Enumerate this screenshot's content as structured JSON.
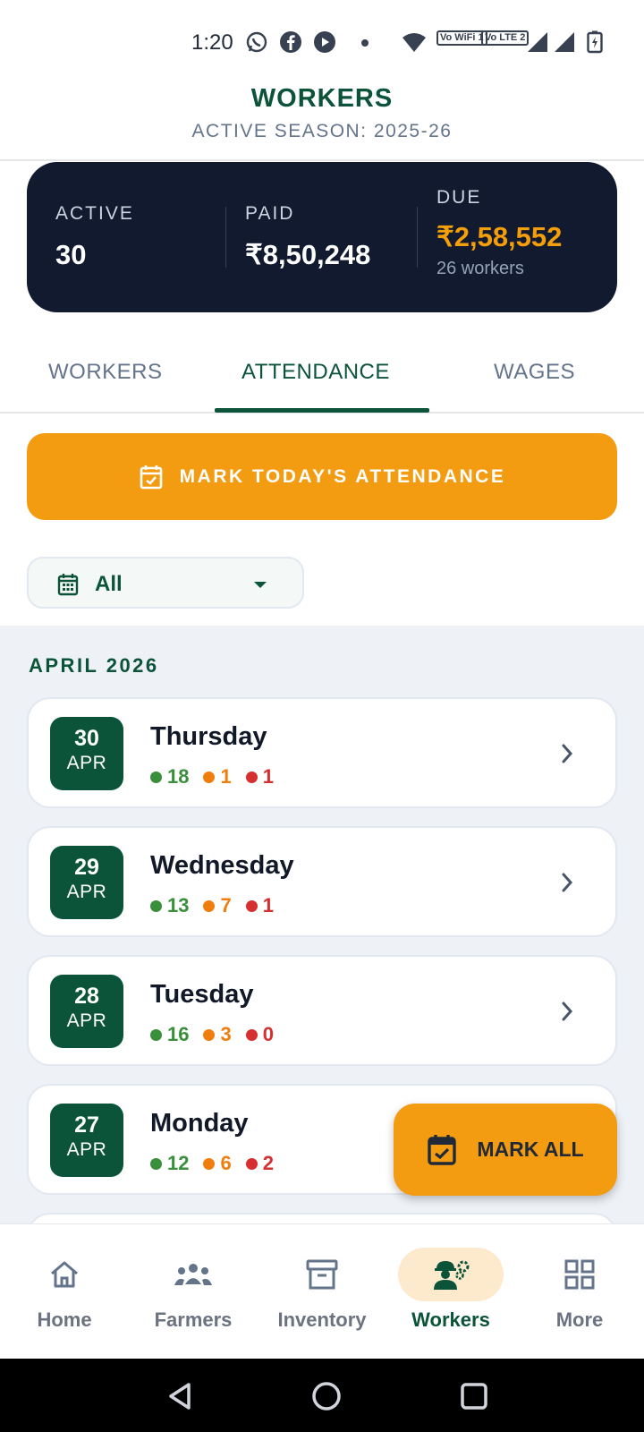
{
  "status_bar": {
    "time": "1:20",
    "icons": [
      "whatsapp-icon",
      "facebook-icon",
      "youtube-icon",
      "dot-icon",
      "wifi-icon",
      "vowifi-icon",
      "volte-icon",
      "signal-icon",
      "signal-icon",
      "battery-icon"
    ],
    "wifi_badge": "Vo WiFi 1",
    "lte_badge": "Vo LTE 2"
  },
  "header": {
    "title": "WORKERS",
    "subtitle": "ACTIVE SEASON: 2025-26"
  },
  "summary": {
    "active": {
      "label": "ACTIVE",
      "value": "30"
    },
    "paid": {
      "label": "PAID",
      "value": "₹8,50,248"
    },
    "due": {
      "label": "DUE",
      "value": "₹2,58,552",
      "note": "26 workers"
    }
  },
  "tabs": [
    {
      "label": "WORKERS",
      "active": false
    },
    {
      "label": "ATTENDANCE",
      "active": true
    },
    {
      "label": "WAGES",
      "active": false
    }
  ],
  "mark_button": {
    "label": "MARK TODAY'S ATTENDANCE",
    "icon": "calendar-check-icon"
  },
  "filter": {
    "selected": "All",
    "icon": "calendar-icon"
  },
  "month_label": "APRIL 2026",
  "days": [
    {
      "date": "30",
      "month": "APR",
      "weekday": "Thursday",
      "present": "18",
      "half": "1",
      "absent": "1"
    },
    {
      "date": "29",
      "month": "APR",
      "weekday": "Wednesday",
      "present": "13",
      "half": "7",
      "absent": "1"
    },
    {
      "date": "28",
      "month": "APR",
      "weekday": "Tuesday",
      "present": "16",
      "half": "3",
      "absent": "0"
    },
    {
      "date": "27",
      "month": "APR",
      "weekday": "Monday",
      "present": "12",
      "half": "6",
      "absent": "2"
    }
  ],
  "fab": {
    "label": "MARK ALL",
    "icon": "calendar-check-icon"
  },
  "bottom_nav": [
    {
      "label": "Home",
      "icon": "home-icon",
      "active": false
    },
    {
      "label": "Farmers",
      "icon": "people-icon",
      "active": false
    },
    {
      "label": "Inventory",
      "icon": "archive-box-icon",
      "active": false
    },
    {
      "label": "Workers",
      "icon": "worker-gear-icon",
      "active": true
    },
    {
      "label": "More",
      "icon": "grid-icon",
      "active": false
    }
  ],
  "colors": {
    "brand_green": "#0b5339",
    "accent_orange": "#f39c12",
    "summary_bg": "#111a2e",
    "due_amber": "#f59e0b",
    "present_green": "#3a8f3a",
    "half_orange": "#f07e0e",
    "absent_red": "#d62f2f"
  }
}
